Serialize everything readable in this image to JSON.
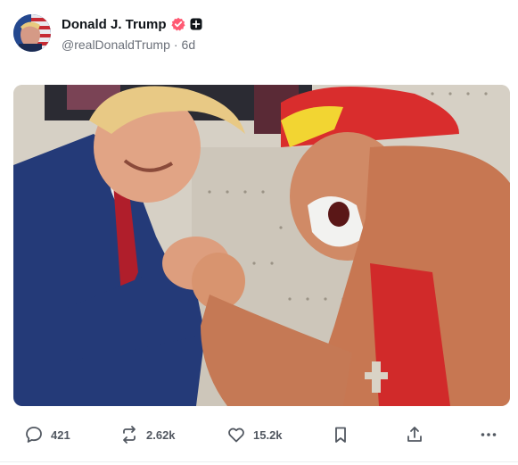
{
  "author": {
    "display_name": "Donald J. Trump",
    "handle": "@realDonaldTrump",
    "separator": "·",
    "time_ago": "6d"
  },
  "colors": {
    "verified_badge": "#ff5a73",
    "text_muted": "#6b7079",
    "icon_gray": "#525861"
  },
  "media": {
    "description_icon": "photo"
  },
  "actions": {
    "reply_count": "421",
    "repost_count": "2.62k",
    "like_count": "15.2k",
    "icons": [
      "reply-icon",
      "repost-icon",
      "like-icon",
      "bookmark-icon",
      "share-icon",
      "more-icon"
    ]
  }
}
